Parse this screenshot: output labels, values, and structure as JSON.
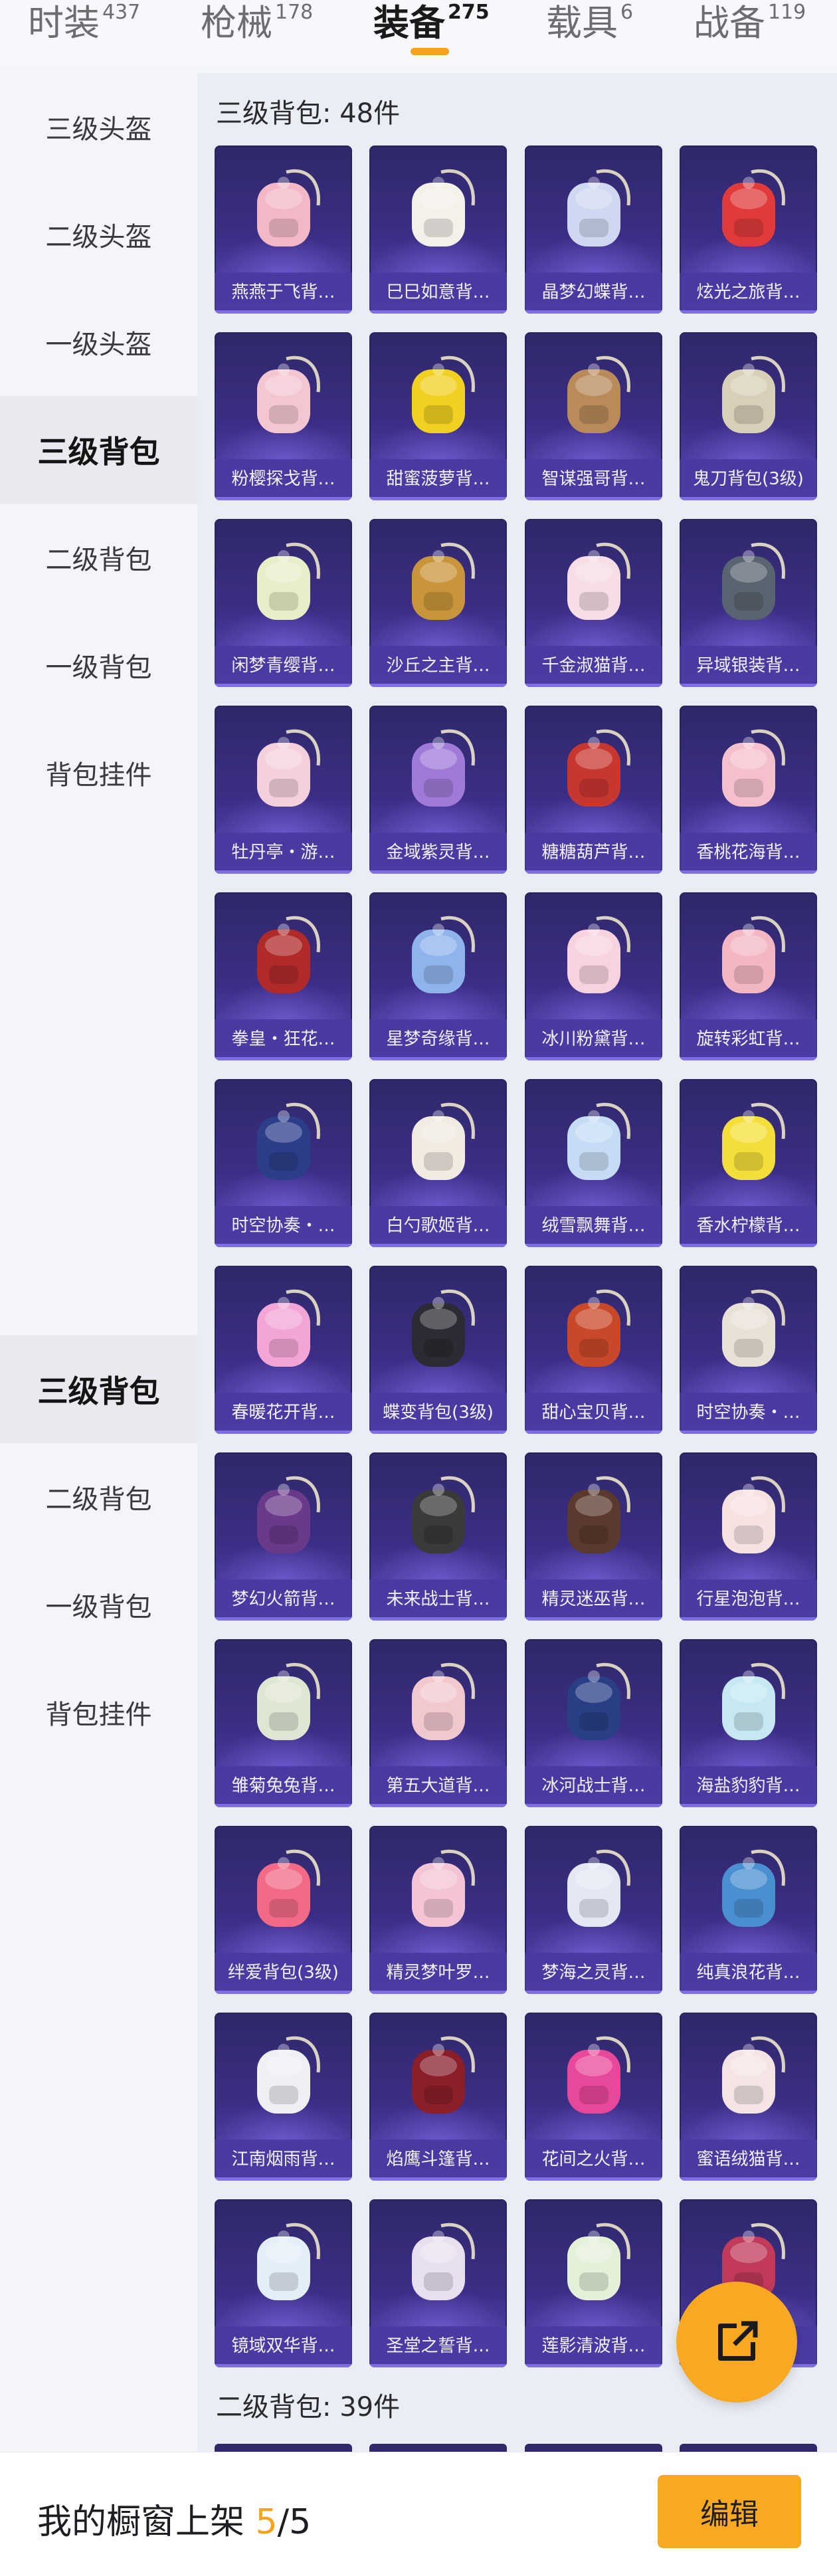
{
  "tabs": [
    {
      "label": "时装",
      "count": "437"
    },
    {
      "label": "枪械",
      "count": "178"
    },
    {
      "label": "装备",
      "count": "275",
      "active": true
    },
    {
      "label": "载具",
      "count": "6"
    },
    {
      "label": "战备",
      "count": "119"
    }
  ],
  "sidebar": {
    "items": [
      "三级头盔",
      "二级头盔",
      "一级头盔",
      "三级背包",
      "二级背包",
      "一级背包",
      "背包挂件",
      "三级背包",
      "二级背包",
      "一级背包",
      "背包挂件"
    ]
  },
  "sections": [
    {
      "label": "三级背包: 48件"
    },
    {
      "label": "二级背包: 39件"
    }
  ],
  "items": [
    "燕燕于飞背…",
    "巳巳如意背…",
    "晶梦幻蝶背…",
    "炫光之旅背…",
    "粉樱探戈背…",
    "甜蜜菠萝背…",
    "智谋强哥背…",
    "鬼刀背包(3级)",
    "闲梦青缨背…",
    "沙丘之主背…",
    "千金淑猫背…",
    "异域银装背…",
    "牡丹亭・游…",
    "金域紫灵背…",
    "糖糖葫芦背…",
    "香桃花海背…",
    "拳皇・狂花…",
    "星梦奇缘背…",
    "冰川粉黛背…",
    "旋转彩虹背…",
    "时空协奏・…",
    "白勺歌姬背…",
    "绒雪飘舞背…",
    "香水柠檬背…",
    "春暖花开背…",
    "蝶变背包(3级)",
    "甜心宝贝背…",
    "时空协奏・…",
    "梦幻火箭背…",
    "未来战士背…",
    "精灵迷巫背…",
    "行星泡泡背…",
    "雏菊兔兔背…",
    "第五大道背…",
    "冰河战士背…",
    "海盐豹豹背…",
    "绊爱背包(3级)",
    "精灵梦叶罗…",
    "梦海之灵背…",
    "纯真浪花背…",
    "江南烟雨背…",
    "焰鹰斗篷背…",
    "花间之火背…",
    "蜜语绒猫背…",
    "镜域双华背…",
    "圣堂之誓背…",
    "莲影清波背…",
    ""
  ],
  "colors": [
    "#f2b8c6",
    "#f4f0ea",
    "#cfd8f0",
    "#e03a3a",
    "#f4c6d2",
    "#f0d020",
    "#b98a5a",
    "#d8cfb8",
    "#e6efc8",
    "#c8953a",
    "#f6dde6",
    "#5a6470",
    "#f3d0dc",
    "#9f7ad8",
    "#c8372f",
    "#f4c0cc",
    "#b02a2a",
    "#8fb4ec",
    "#f7d3df",
    "#f3b7c3",
    "#2c3e8a",
    "#f1ebe2",
    "#c6dcf4",
    "#f4df3a",
    "#f3a6d6",
    "#2b2b33",
    "#c8482a",
    "#e8e1d6",
    "#6a3a8a",
    "#3a3a3a",
    "#5a3a2e",
    "#f7e2e2",
    "#dfe6d2",
    "#f2c8cf",
    "#2a3e86",
    "#c6e8f2",
    "#f26a86",
    "#f4c4d6",
    "#e4e8f4",
    "#4a8fd0",
    "#eef0f4",
    "#8a1f2a",
    "#e8489a",
    "#f4e4e4",
    "#e4eef8",
    "#e8dff0",
    "#e4f0d8",
    "#c23a5a"
  ],
  "bottom": {
    "label": "我的橱窗上架",
    "current": "5",
    "total": "/5",
    "edit": "编辑"
  }
}
